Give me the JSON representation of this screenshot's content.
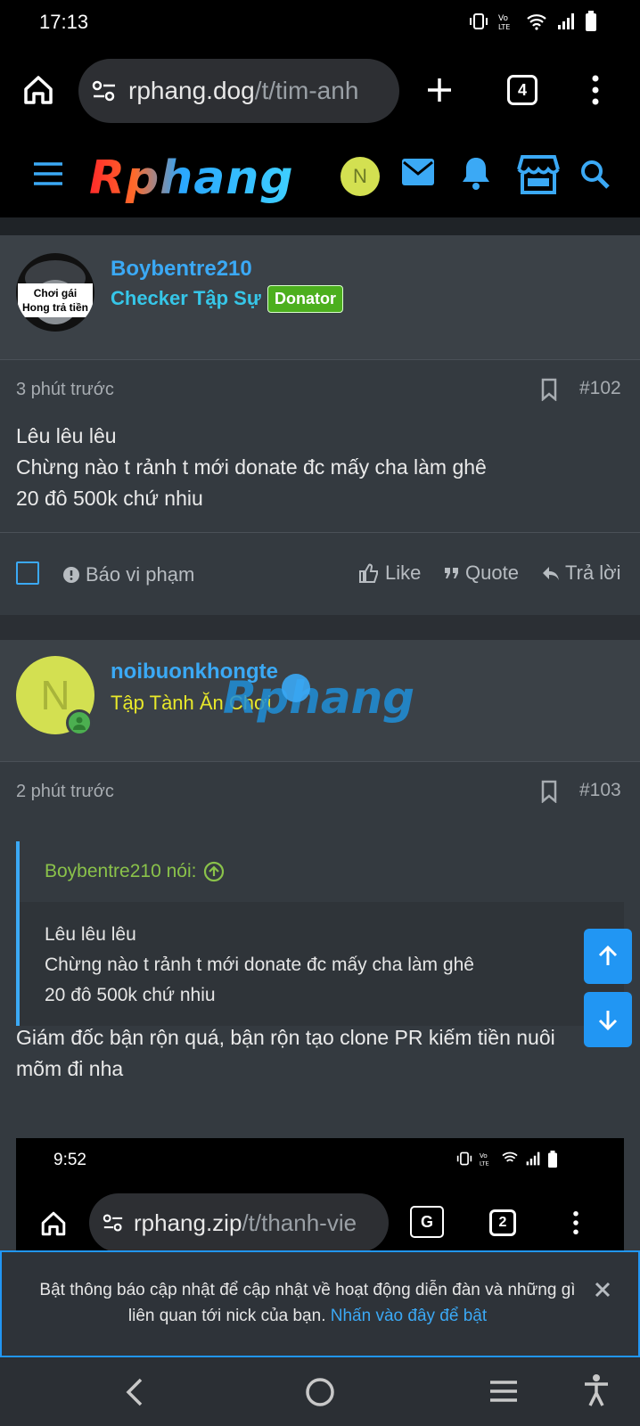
{
  "status_bar": {
    "time": "17:13"
  },
  "browser": {
    "url_host": "rphang.dog",
    "url_path": "/t/tim-anh",
    "tab_count": "4"
  },
  "site_header": {
    "logo_text": "Rphang",
    "user_initial": "N"
  },
  "posts": [
    {
      "username": "Boybentre210",
      "user_title": "Checker Tập Sự",
      "badge": "Donator",
      "avatar_text_line1": "Chơi gái",
      "avatar_text_line2": "Hong trả tiền",
      "time": "3 phút trước",
      "number": "#102",
      "lines": [
        "Lêu lêu lêu",
        "Chừng nào t rảnh t mới donate đc mấy cha làm ghê",
        "20 đô 500k chứ nhiu"
      ],
      "actions": {
        "report": "Báo vi phạm",
        "like": "Like",
        "quote": "Quote",
        "reply": "Trả lời"
      }
    },
    {
      "username": "noibuonkhongte",
      "user_title": "Tập Tành Ăn Chơi",
      "avatar_initial": "N",
      "watermark": "Rphang",
      "time": "2 phút trước",
      "number": "#103",
      "quote_author": "Boybentre210 nói:",
      "quote_lines": [
        "Lêu lêu lêu",
        "Chừng nào t rảnh t mới donate đc mấy cha làm ghê",
        "20 đô 500k chứ nhiu"
      ],
      "lines": [
        "Giám đốc bận rộn quá, bận rộn tạo clone PR kiếm tiền nuôi",
        "mõm đi nha"
      ],
      "embedded_screenshot": {
        "time": "9:52",
        "url_host": "rphang.zip",
        "url_path": "/t/thanh-vie",
        "tab_count": "2"
      }
    }
  ],
  "notice": {
    "text": "Bật thông báo cập nhật để cập nhật về hoạt động diễn đàn và những gì liên quan tới nick của bạn.",
    "link": "Nhấn vào đây để bật"
  },
  "colors": {
    "accent": "#3ba9f5",
    "donator_badge": "#4caf1e",
    "checker_title": "#36c6e8",
    "member_title": "#e8e82a",
    "quote_author": "#8ac24a"
  }
}
